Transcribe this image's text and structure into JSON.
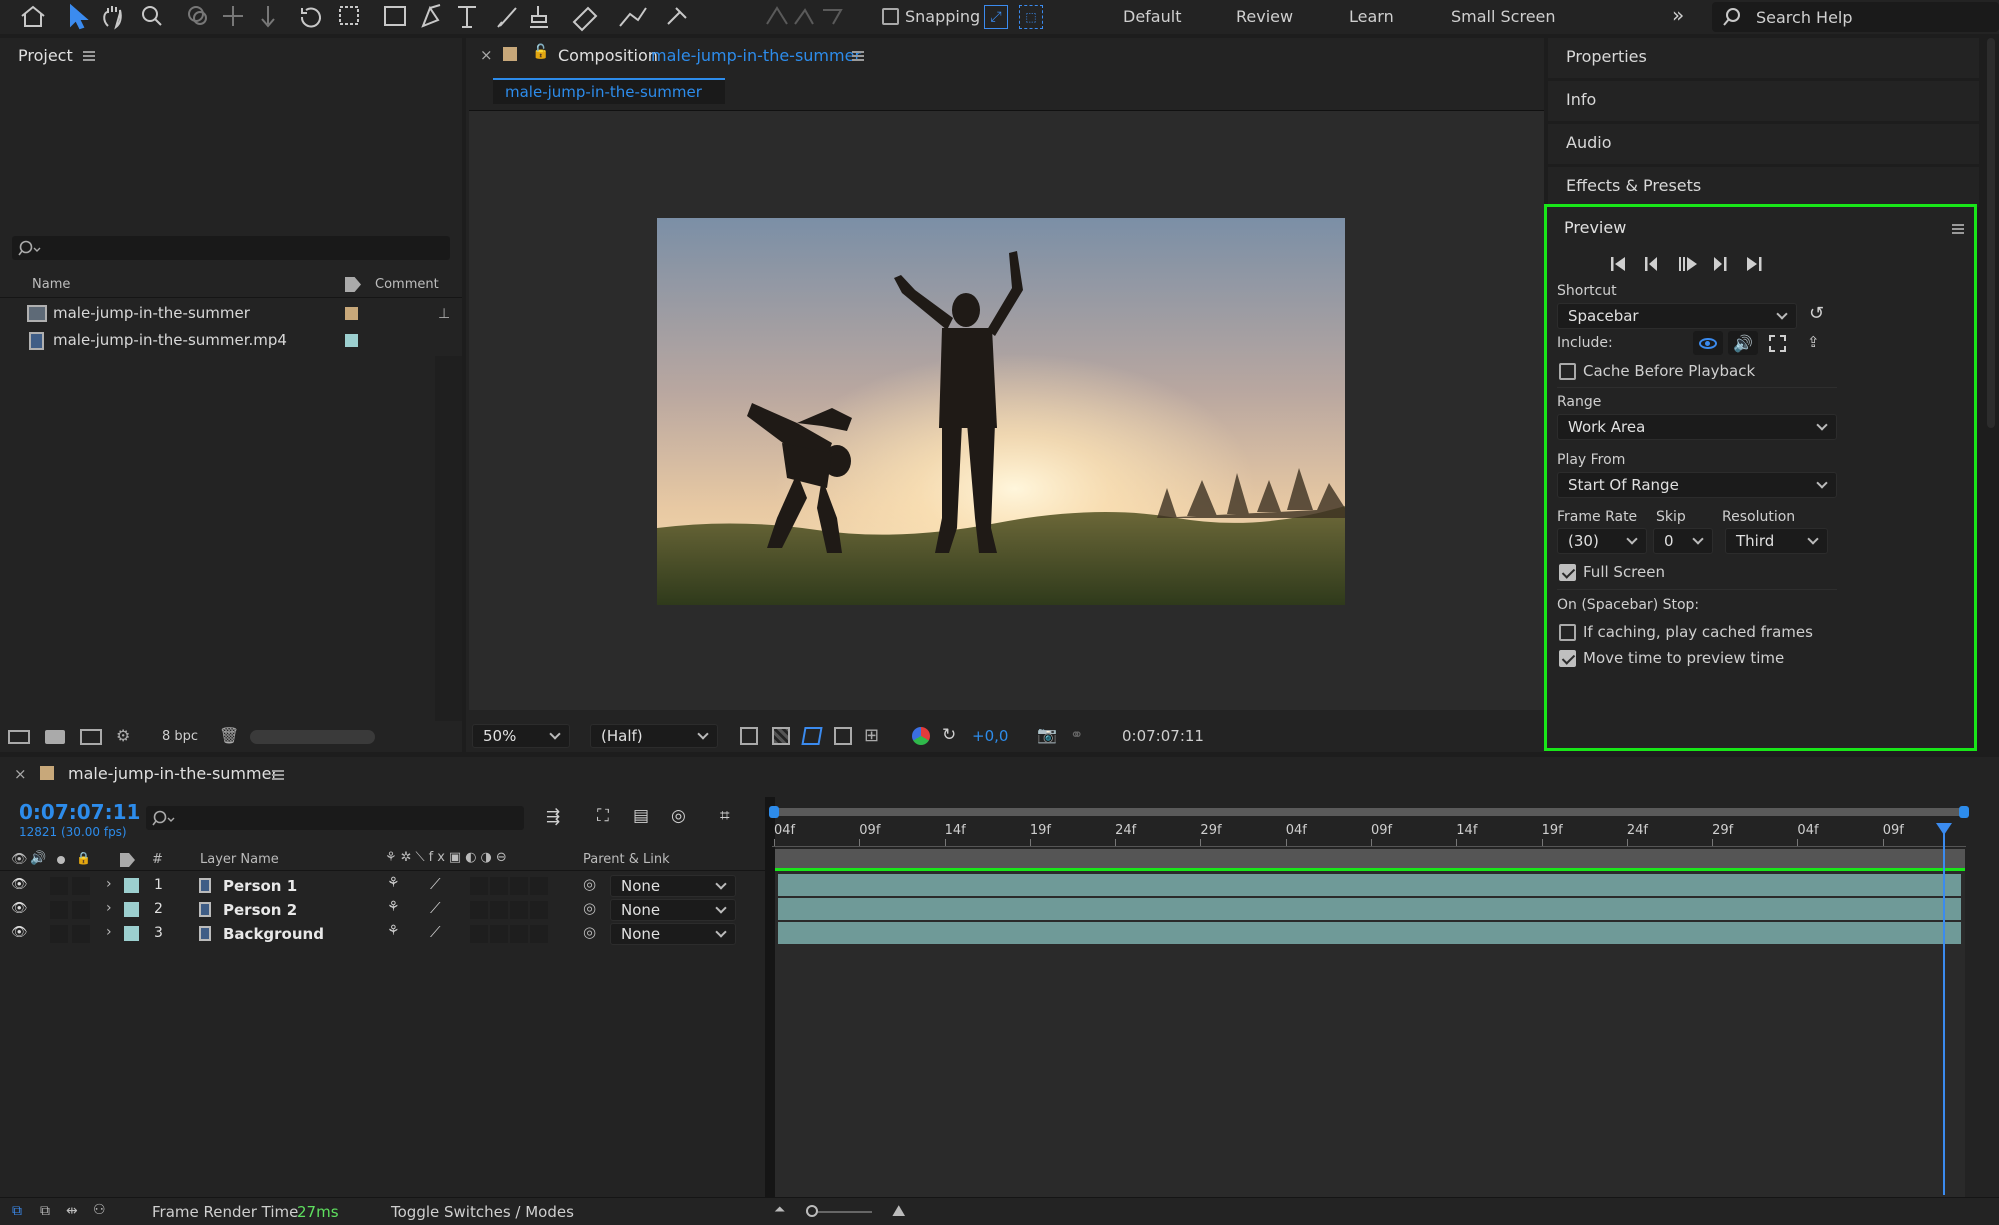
{
  "toolbar": {
    "snapping_label": "Snapping",
    "workspaces": [
      "Default",
      "Review",
      "Learn",
      "Small Screen"
    ],
    "more_icon": "double-chevron-icon",
    "search_placeholder": "Search Help"
  },
  "project": {
    "title": "Project",
    "search_placeholder": "",
    "col_name": "Name",
    "col_comment": "Comment",
    "items": [
      {
        "name": "male-jump-in-the-summer",
        "type": "composition",
        "label_color": "#c8a87a"
      },
      {
        "name": "male-jump-in-the-summer.mp4",
        "type": "footage",
        "label_color": "#9ccfcf"
      }
    ],
    "bpc_label": "8 bpc"
  },
  "composition": {
    "tab_prefix": "Composition",
    "tab_name": "male-jump-in-the-summer",
    "subtab": "male-jump-in-the-summer",
    "zoom": "50%",
    "resolution": "(Half)",
    "exposure": "+0,0",
    "timecode": "0:07:07:11"
  },
  "right_panels": {
    "items": [
      "Properties",
      "Info",
      "Audio",
      "Effects & Presets"
    ]
  },
  "preview": {
    "title": "Preview",
    "shortcut_label": "Shortcut",
    "shortcut_value": "Spacebar",
    "include_label": "Include:",
    "cache_label": "Cache Before Playback",
    "cache_checked": false,
    "range_label": "Range",
    "range_value": "Work Area",
    "play_from_label": "Play From",
    "play_from_value": "Start Of Range",
    "frame_rate_label": "Frame Rate",
    "frame_rate_value": "(30)",
    "skip_label": "Skip",
    "skip_value": "0",
    "resolution_label": "Resolution",
    "resolution_value": "Third",
    "full_screen_label": "Full Screen",
    "full_screen_checked": true,
    "stop_label": "On (Spacebar) Stop:",
    "if_caching_label": "If caching, play cached frames",
    "if_caching_checked": false,
    "move_time_label": "Move time to preview time",
    "move_time_checked": true,
    "highlight_color": "#19e619"
  },
  "timeline": {
    "comp_name": "male-jump-in-the-summer",
    "timecode": "0:07:07:11",
    "frame_info": "12821 (30.00 fps)",
    "col_num": "#",
    "col_layer_name": "Layer Name",
    "col_parent": "Parent & Link",
    "ruler": [
      "04f",
      "09f",
      "14f",
      "19f",
      "24f",
      "29f",
      "04f",
      "09f",
      "14f",
      "19f",
      "24f",
      "29f",
      "04f",
      "09f"
    ],
    "layers": [
      {
        "num": "1",
        "name": "Person 1",
        "parent": "None"
      },
      {
        "num": "2",
        "name": "Person 2",
        "parent": "None"
      },
      {
        "num": "3",
        "name": "Background",
        "parent": "None"
      }
    ]
  },
  "status": {
    "frame_render_label": "Frame Render Time",
    "frame_render_value": "27ms",
    "toggle_label": "Toggle Switches / Modes"
  }
}
